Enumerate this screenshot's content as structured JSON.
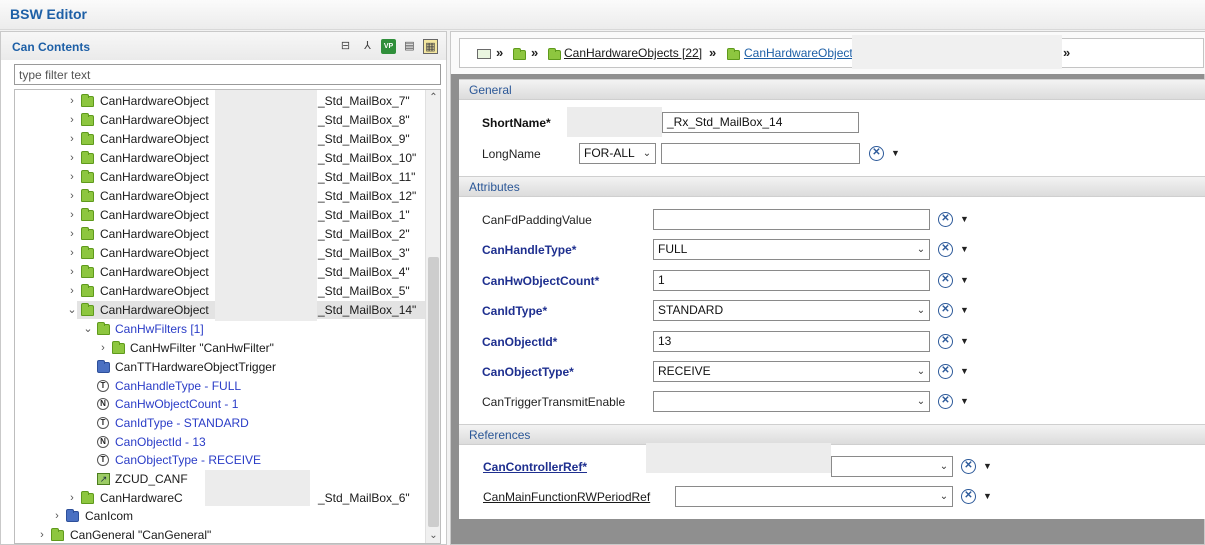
{
  "window": {
    "title": "BSW Editor"
  },
  "left_panel": {
    "title": "Can Contents",
    "filter_placeholder": "type filter text",
    "tree": [
      {
        "label": "CanHardwareObject",
        "tail": "_Std_MailBox_7\""
      },
      {
        "label": "CanHardwareObject",
        "tail": "_Std_MailBox_8\""
      },
      {
        "label": "CanHardwareObject",
        "tail": "_Std_MailBox_9\""
      },
      {
        "label": "CanHardwareObject",
        "tail": "_Std_MailBox_10\""
      },
      {
        "label": "CanHardwareObject",
        "tail": "_Std_MailBox_11\""
      },
      {
        "label": "CanHardwareObject",
        "tail": "_Std_MailBox_12\""
      },
      {
        "label": "CanHardwareObject",
        "tail": "_Std_MailBox_1\""
      },
      {
        "label": "CanHardwareObject",
        "tail": "_Std_MailBox_2\""
      },
      {
        "label": "CanHardwareObject",
        "tail": "_Std_MailBox_3\""
      },
      {
        "label": "CanHardwareObject",
        "tail": "_Std_MailBox_4\""
      },
      {
        "label": "CanHardwareObject",
        "tail": "_Std_MailBox_5\""
      },
      {
        "label": "CanHardwareObject",
        "tail": "_Std_MailBox_14\""
      },
      {
        "label": "CanHwFilters [1]"
      },
      {
        "label": "CanHwFilter \"CanHwFilter\""
      },
      {
        "label": "CanTTHardwareObjectTrigger"
      },
      {
        "label": "CanHandleType - FULL"
      },
      {
        "label": "CanHwObjectCount - 1"
      },
      {
        "label": "CanIdType - STANDARD"
      },
      {
        "label": "CanObjectId - 13"
      },
      {
        "label": "CanObjectType - RECEIVE"
      },
      {
        "label": "ZCUD_CANF"
      },
      {
        "label": "CanHardwareC",
        "tail": "_Std_MailBox_6\""
      },
      {
        "label": "CanIcom"
      },
      {
        "label": "CanGeneral \"CanGeneral\""
      }
    ]
  },
  "breadcrumb": {
    "items": [
      "CanHardwareObjects [22]",
      "CanHardwareObject"
    ]
  },
  "general": {
    "section": "General",
    "shortname_label": "ShortName*",
    "shortname_value": "_Rx_Std_MailBox_14",
    "longname_label": "LongName",
    "longname_lang": "FOR-ALL",
    "longname_value": ""
  },
  "attributes": {
    "section": "Attributes",
    "fields": [
      {
        "label": "CanFdPaddingValue",
        "value": ""
      },
      {
        "label": "CanHandleType*",
        "value": "FULL"
      },
      {
        "label": "CanHwObjectCount*",
        "value": "1"
      },
      {
        "label": "CanIdType*",
        "value": "STANDARD"
      },
      {
        "label": "CanObjectId*",
        "value": "13"
      },
      {
        "label": "CanObjectType*",
        "value": "RECEIVE"
      },
      {
        "label": "CanTriggerTransmitEnable",
        "value": ""
      }
    ]
  },
  "references": {
    "section": "References",
    "fields": [
      {
        "label": "CanControllerRef*",
        "value": ""
      },
      {
        "label": "CanMainFunctionRWPeriodRef",
        "value": ""
      }
    ]
  },
  "icons": {
    "collapse": "collapse-all-icon",
    "tree": "hierarchy-icon",
    "vp": "vp-icon",
    "doc": "document-icon",
    "grid": "layout-icon",
    "clear": "clear-x-icon"
  }
}
